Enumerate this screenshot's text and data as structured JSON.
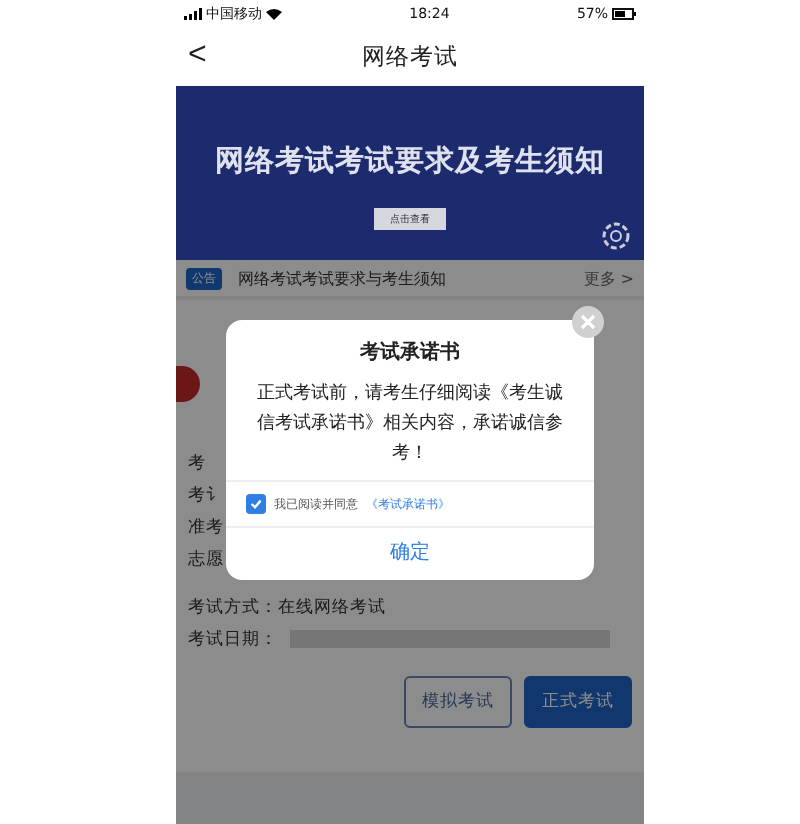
{
  "status_bar": {
    "carrier": "中国移动",
    "time": "18:24",
    "battery": "57%"
  },
  "nav": {
    "back": "<",
    "title": "网络考试"
  },
  "banner": {
    "title": "网络考试考试要求及考生须知",
    "button": "点击查看"
  },
  "notice": {
    "tag": "公告",
    "text": "网络考试考试要求与考生须知",
    "more": "更多 >"
  },
  "info_rows": [
    {
      "label": "考"
    },
    {
      "label": "考讠"
    },
    {
      "label": "准考"
    },
    {
      "label": "志愿"
    }
  ],
  "exam_mode": "考试方式：在线网络考试",
  "exam_date": {
    "label": "考试日期："
  },
  "actions": [
    {
      "label": "模拟考试",
      "kind": "outline"
    },
    {
      "label": "正式考试",
      "kind": "primary"
    }
  ],
  "dialog": {
    "title": "考试承诺书",
    "message": "正式考试前，请考生仔细阅读《考生诚信考试承诺书》相关内容，承诺诚信参考！",
    "agree": {
      "checked": true,
      "text": "我已阅读并同意",
      "link": "《考试承诺书》"
    },
    "confirm": "确定"
  }
}
